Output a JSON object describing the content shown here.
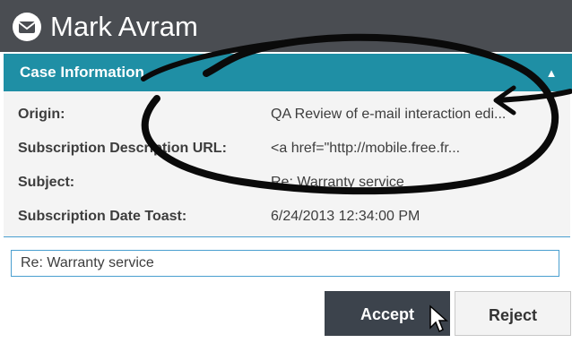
{
  "window": {
    "title": "Mark Avram",
    "icon": "envelope-icon"
  },
  "case_panel": {
    "header": "Case Information",
    "collapse_icon": "chevron-up-icon",
    "fields": [
      {
        "label": "Origin:",
        "value": "QA Review of e-mail interaction edi..."
      },
      {
        "label": "Subscription Description URL:",
        "value": "<a href=\"http://mobile.free.fr..."
      },
      {
        "label": "Subject:",
        "value": "Re: Warranty service"
      },
      {
        "label": "Subscription Date Toast:",
        "value": "6/24/2013 12:34:00 PM"
      }
    ]
  },
  "reply": {
    "value": "Re: Warranty service"
  },
  "actions": {
    "accept_label": "Accept",
    "reject_label": "Reject"
  },
  "colors": {
    "titlebar": "#4a4d52",
    "case_header": "#1f8fa5",
    "accept_button": "#3c434c",
    "focus_border": "#4a9fd0"
  }
}
